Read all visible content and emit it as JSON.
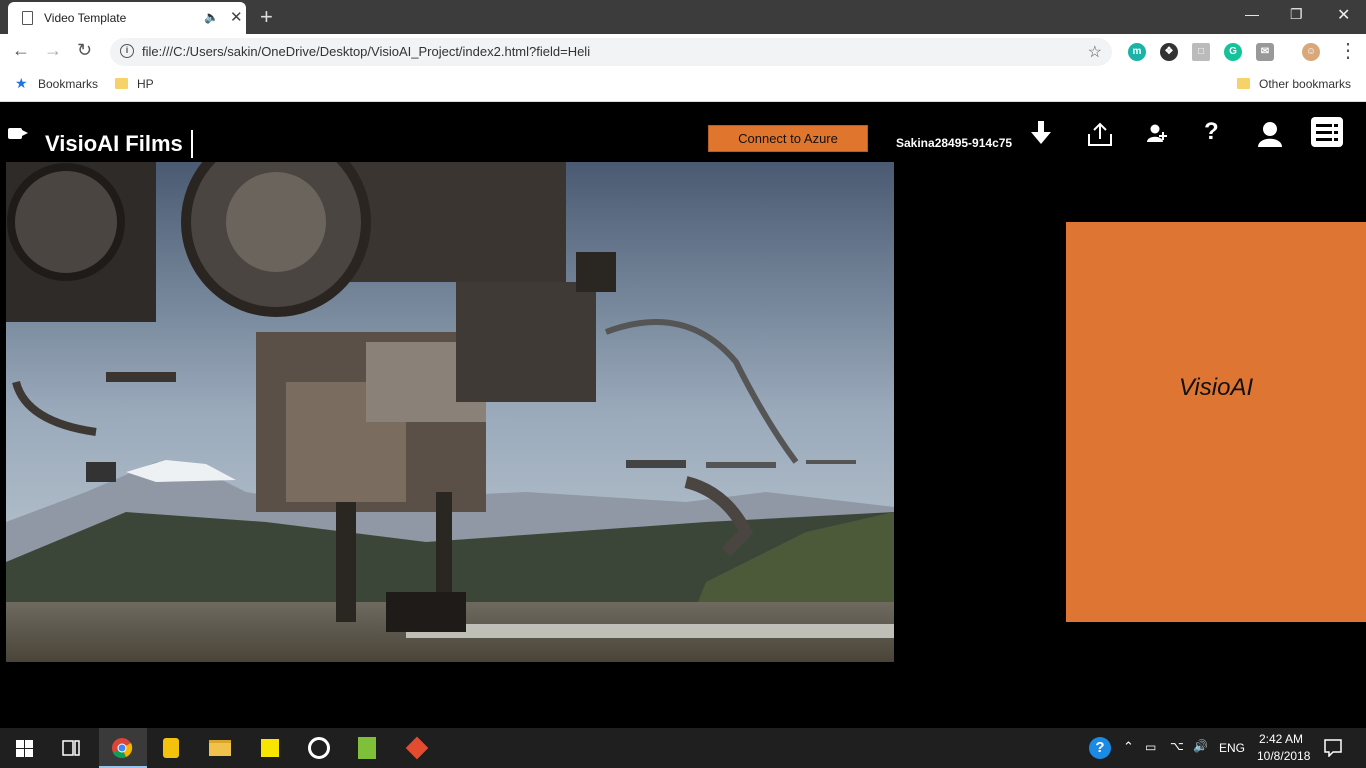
{
  "browser": {
    "tab_title": "Video Template",
    "url": "file:///C:/Users/sakin/OneDrive/Desktop/VisioAI_Project/index2.html?field=Heli",
    "bookmarks": [
      {
        "label": "Bookmarks"
      },
      {
        "label": "HP"
      }
    ],
    "other_bookmarks": "Other bookmarks"
  },
  "app": {
    "brand": "VisioAI Films",
    "connect_label": "Connect to Azure",
    "user_id": "Sakina28495-914c75",
    "side_panel_label": "VisioAI",
    "accent_color": "#de7532"
  },
  "taskbar": {
    "language": "ENG",
    "time": "2:42 AM",
    "date": "10/8/2018"
  }
}
